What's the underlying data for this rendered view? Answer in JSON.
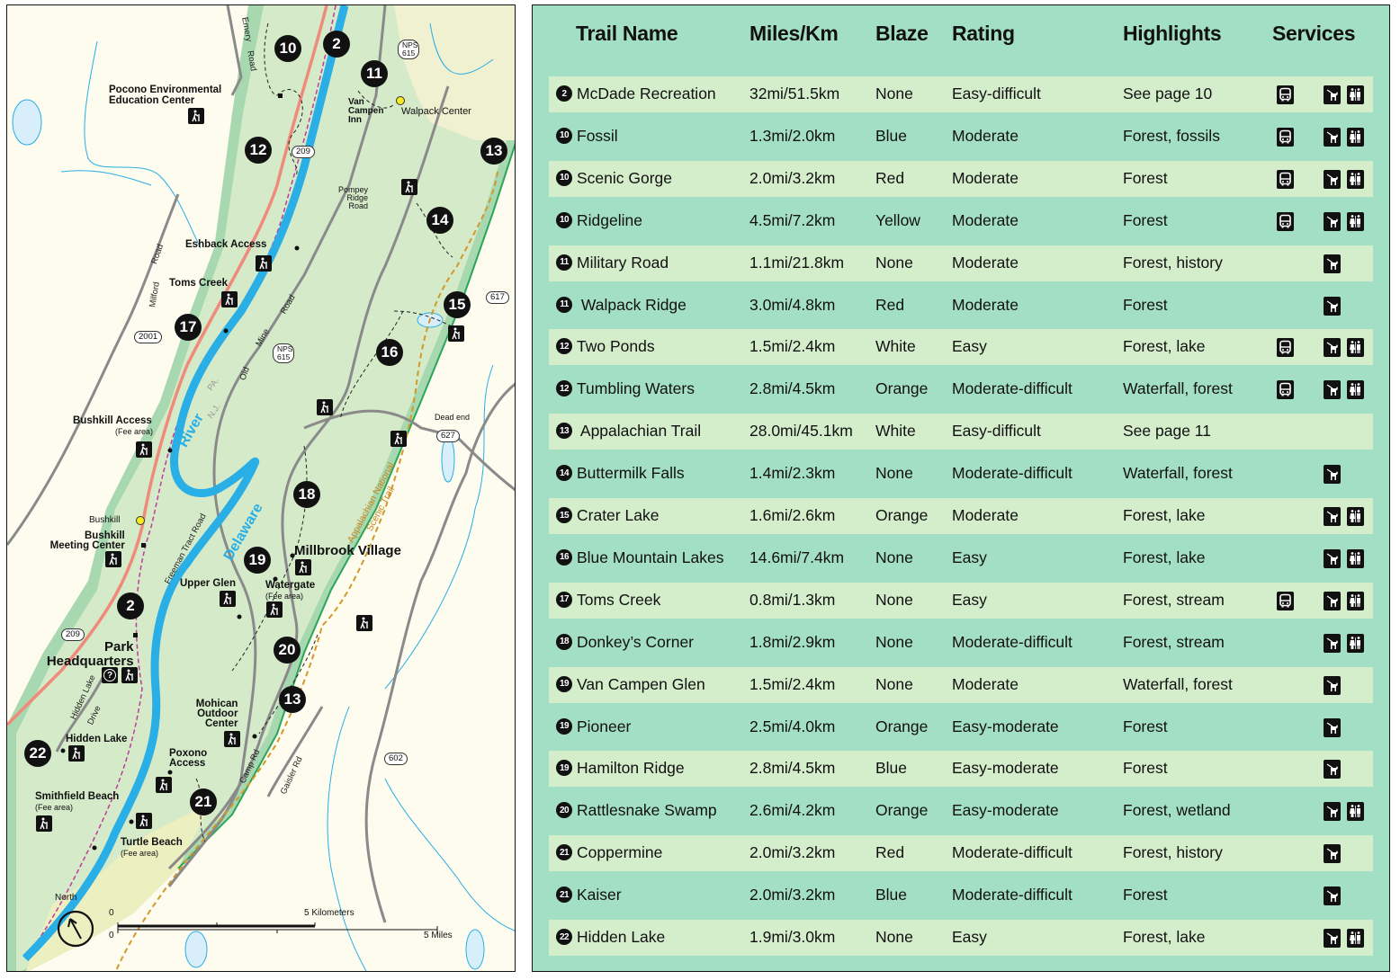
{
  "map": {
    "title": "Delaware Water Gap trails map",
    "colors": {
      "park_land": "#d4eac9",
      "park_border_band": "#9fd2a8",
      "outside_land": "#fdfcef",
      "water": "#29aee6",
      "lake_fill": "#d8eefa",
      "road": "#8a8a8a",
      "us_highway": "#f08a7a",
      "appalachian_trail": "#d19a2a",
      "trail_dashed": "#222222",
      "state_line": "#c03c9a"
    },
    "markers": [
      {
        "num": "10"
      },
      {
        "num": "2"
      },
      {
        "num": "11"
      },
      {
        "num": "12"
      },
      {
        "num": "13"
      },
      {
        "num": "14"
      },
      {
        "num": "15"
      },
      {
        "num": "17"
      },
      {
        "num": "16"
      },
      {
        "num": "18"
      },
      {
        "num": "19"
      },
      {
        "num": "2"
      },
      {
        "num": "20"
      },
      {
        "num": "13"
      },
      {
        "num": "22"
      },
      {
        "num": "21"
      }
    ],
    "places": {
      "pocono_env_1": "Pocono Environmental",
      "pocono_env_2": "Education Center",
      "van_campen_1": "Van",
      "van_campen_2": "Campen",
      "van_campen_3": "Inn",
      "walpack_center": "Walpack Center",
      "eshback_access": "Eshback Access",
      "toms_creek": "Toms Creek",
      "bushkill_access": "Bushkill Access",
      "bushkill_access_fee": "(Fee area)",
      "bushkill": "Bushkill",
      "bushkill_meeting_1": "Bushkill",
      "bushkill_meeting_2": "Meeting Center",
      "millbrook_village": "Millbrook Village",
      "upper_glen": "Upper Glen",
      "watergate": "Watergate",
      "watergate_fee": "(Fee area)",
      "park_hq_1": "Park",
      "park_hq_2": "Headquarters",
      "mohican_1": "Mohican",
      "mohican_2": "Outdoor",
      "mohican_3": "Center",
      "hidden_lake": "Hidden Lake",
      "poxono_1": "Poxono",
      "poxono_2": "Access",
      "smithfield_beach": "Smithfield Beach",
      "smithfield_fee": "(Fee area)",
      "turtle_beach": "Turtle Beach",
      "turtle_fee": "(Fee area)",
      "dead_end": "Dead end"
    },
    "roads": {
      "emery_road_1": "Emery",
      "emery_road_2": "Road",
      "pompey_1": "Pompey",
      "pompey_2": "Ridge",
      "pompey_3": "Road",
      "milford_1": "Milford",
      "milford_2": "Road",
      "old_mine_1": "Old",
      "old_mine_2": "Mine",
      "old_mine_3": "Road",
      "freeman_tract": "Freeman Tract Road",
      "hidden_lake_drive_1": "Hidden Lake",
      "hidden_lake_drive_2": "Drive",
      "camp_rd": "Camp Rd",
      "gaisler_rd": "Gaisler Rd"
    },
    "shields": {
      "nps615_top": "NPS 615",
      "us209_top": "209",
      "r617": "617",
      "r2001": "2001",
      "nps615_mid": "NPS 615",
      "r627": "627",
      "us209_bottom": "209",
      "r602": "602"
    },
    "water_labels": {
      "river": "River",
      "delaware": "Delaware",
      "pa": "PA.",
      "nj": "N.J."
    },
    "at_label_1": "Appalachian National",
    "at_label_2": "Scenic Trail",
    "info_icon": "?",
    "north_label": "North",
    "scale": {
      "km_zero": "0",
      "km_label": "5 Kilometers",
      "mi_zero": "0",
      "mi_label": "5 Miles"
    }
  },
  "table": {
    "background": "#a3dfc4",
    "row_alt_background": "#d4edcb",
    "headers": {
      "trail_name": "Trail Name",
      "miles_km": "Miles/Km",
      "blaze": "Blaze",
      "rating": "Rating",
      "highlights": "Highlights",
      "services": "Services"
    },
    "rows": [
      {
        "num": "2",
        "name": "McDade Recreation",
        "distance": "32mi/51.5km",
        "blaze": "None",
        "rating": "Easy-difficult",
        "highlights": "See page 10",
        "shuttle": true,
        "pets": true,
        "restrooms": true
      },
      {
        "num": "10",
        "name": "Fossil",
        "distance": "1.3mi/2.0km",
        "blaze": "Blue",
        "rating": "Moderate",
        "highlights": "Forest, fossils",
        "shuttle": true,
        "pets": true,
        "restrooms": true
      },
      {
        "num": "10",
        "name": "Scenic Gorge",
        "distance": "2.0mi/3.2km",
        "blaze": "Red",
        "rating": "Moderate",
        "highlights": "Forest",
        "shuttle": true,
        "pets": true,
        "restrooms": true
      },
      {
        "num": "10",
        "name": "Ridgeline",
        "distance": "4.5mi/7.2km",
        "blaze": "Yellow",
        "rating": "Moderate",
        "highlights": "Forest",
        "shuttle": true,
        "pets": true,
        "restrooms": true
      },
      {
        "num": "11",
        "name": "Military Road",
        "distance": "1.1mi/21.8km",
        "blaze": "None",
        "rating": "Moderate",
        "highlights": "Forest, history",
        "shuttle": false,
        "pets": true,
        "restrooms": false
      },
      {
        "num": "11",
        "name": " Walpack Ridge",
        "distance": "3.0mi/4.8km",
        "blaze": "Red",
        "rating": "Moderate",
        "highlights": "Forest",
        "shuttle": false,
        "pets": true,
        "restrooms": false
      },
      {
        "num": "12",
        "name": "Two Ponds",
        "distance": "1.5mi/2.4km",
        "blaze": "White",
        "rating": "Easy",
        "highlights": "Forest, lake",
        "shuttle": true,
        "pets": true,
        "restrooms": true
      },
      {
        "num": "12",
        "name": "Tumbling Waters",
        "distance": "2.8mi/4.5km",
        "blaze": "Orange",
        "rating": "Moderate-difficult",
        "highlights": "Waterfall, forest",
        "shuttle": true,
        "pets": true,
        "restrooms": true
      },
      {
        "num": "13",
        "name": " Appalachian Trail",
        "distance": "28.0mi/45.1km",
        "blaze": "White",
        "rating": "Easy-difficult",
        "highlights": "See page 11",
        "shuttle": false,
        "pets": false,
        "restrooms": false
      },
      {
        "num": "14",
        "name": "Buttermilk Falls",
        "distance": "1.4mi/2.3km",
        "blaze": "None",
        "rating": "Moderate-difficult",
        "highlights": "Waterfall, forest",
        "shuttle": false,
        "pets": true,
        "restrooms": false
      },
      {
        "num": "15",
        "name": "Crater Lake",
        "distance": "1.6mi/2.6km",
        "blaze": "Orange",
        "rating": "Moderate",
        "highlights": "Forest, lake",
        "shuttle": false,
        "pets": true,
        "restrooms": true
      },
      {
        "num": "16",
        "name": "Blue Mountain Lakes",
        "distance": "14.6mi/7.4km",
        "blaze": "None",
        "rating": "Easy",
        "highlights": "Forest, lake",
        "shuttle": false,
        "pets": true,
        "restrooms": true
      },
      {
        "num": "17",
        "name": "Toms Creek",
        "distance": "0.8mi/1.3km",
        "blaze": "None",
        "rating": "Easy",
        "highlights": "Forest, stream",
        "shuttle": true,
        "pets": true,
        "restrooms": true
      },
      {
        "num": "18",
        "name": "Donkey’s Corner",
        "distance": "1.8mi/2.9km",
        "blaze": "None",
        "rating": "Moderate-difficult",
        "highlights": "Forest, stream",
        "shuttle": false,
        "pets": true,
        "restrooms": true
      },
      {
        "num": "19",
        "name": "Van Campen Glen",
        "distance": "1.5mi/2.4km",
        "blaze": "None",
        "rating": "Moderate",
        "highlights": "Waterfall, forest",
        "shuttle": false,
        "pets": true,
        "restrooms": false
      },
      {
        "num": "19",
        "name": "Pioneer",
        "distance": "2.5mi/4.0km",
        "blaze": "Orange",
        "rating": "Easy-moderate",
        "highlights": "Forest",
        "shuttle": false,
        "pets": true,
        "restrooms": false
      },
      {
        "num": "19",
        "name": "Hamilton Ridge",
        "distance": "2.8mi/4.5km",
        "blaze": "Blue",
        "rating": "Easy-moderate",
        "highlights": "Forest",
        "shuttle": false,
        "pets": true,
        "restrooms": false
      },
      {
        "num": "20",
        "name": "Rattlesnake Swamp",
        "distance": "2.6mi/4.2km",
        "blaze": "Orange",
        "rating": "Easy-moderate",
        "highlights": "Forest, wetland",
        "shuttle": false,
        "pets": true,
        "restrooms": true
      },
      {
        "num": "21",
        "name": "Coppermine",
        "distance": "2.0mi/3.2km",
        "blaze": "Red",
        "rating": "Moderate-difficult",
        "highlights": "Forest, history",
        "shuttle": false,
        "pets": true,
        "restrooms": false
      },
      {
        "num": "21",
        "name": "Kaiser",
        "distance": "2.0mi/3.2km",
        "blaze": "Blue",
        "rating": "Moderate-difficult",
        "highlights": "Forest",
        "shuttle": false,
        "pets": true,
        "restrooms": false
      },
      {
        "num": "22",
        "name": "Hidden Lake",
        "distance": "1.9mi/3.0km",
        "blaze": "None",
        "rating": "Easy",
        "highlights": "Forest, lake",
        "shuttle": false,
        "pets": true,
        "restrooms": true
      }
    ],
    "service_icons": {
      "shuttle": "bus-icon",
      "pets": "leashed-pet-icon",
      "restrooms": "restroom-icon"
    }
  }
}
